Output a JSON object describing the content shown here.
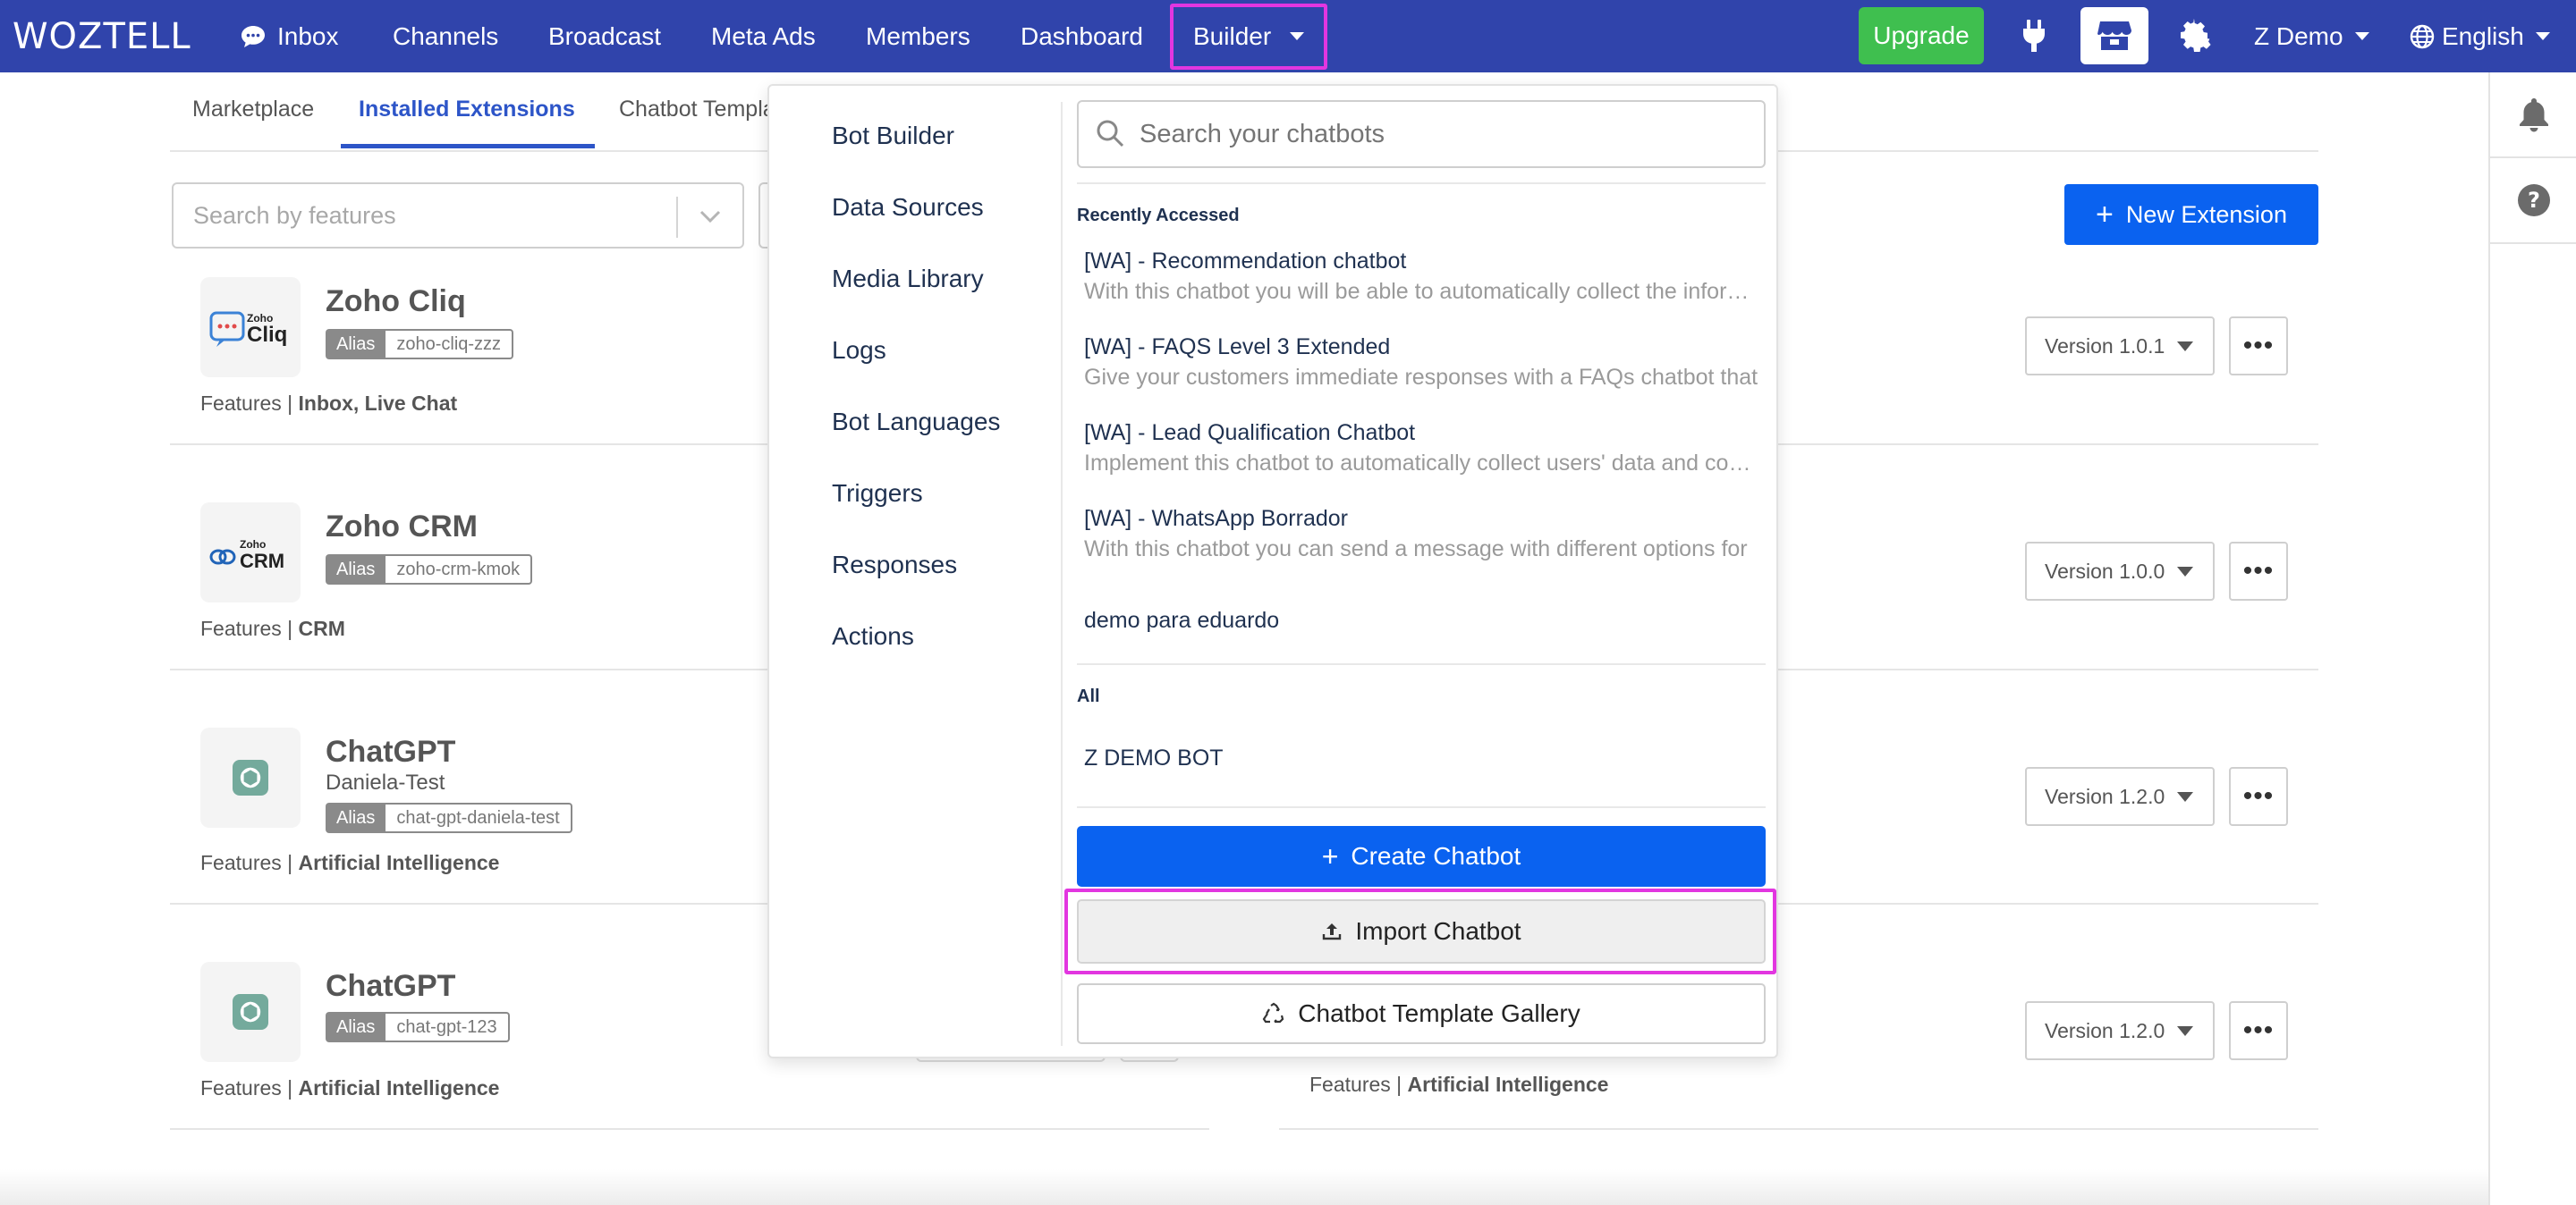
{
  "brand": {
    "logo_text": "WOZTELL"
  },
  "nav": {
    "inbox": "Inbox",
    "channels": "Channels",
    "broadcast": "Broadcast",
    "meta_ads": "Meta Ads",
    "members": "Members",
    "dashboard": "Dashboard",
    "builder": "Builder",
    "upgrade": "Upgrade",
    "account": "Z Demo",
    "language": "English"
  },
  "tabs": {
    "marketplace": "Marketplace",
    "installed": "Installed Extensions",
    "chatbot_templates": "Chatbot Templa"
  },
  "filters": {
    "feature_search_placeholder": "Search by features",
    "new_extension": "New Extension"
  },
  "extensions": [
    {
      "name": "Zoho Cliq",
      "subtitle": "",
      "alias_key": "Alias",
      "alias": "zoho-cliq-zzz",
      "features_label": "Features |",
      "features": "Inbox, Live Chat",
      "version": "Version 1.0.1",
      "logo_line1": "Zoho",
      "logo_line2": "Cliq"
    },
    {
      "name": "Zoho CRM",
      "subtitle": "",
      "alias_key": "Alias",
      "alias": "zoho-crm-kmok",
      "features_label": "Features |",
      "features": "CRM",
      "version": "Version 1.0.0",
      "logo_line1": "Zoho",
      "logo_line2": "CRM"
    },
    {
      "name": "ChatGPT",
      "subtitle": "Daniela-Test",
      "alias_key": "Alias",
      "alias": "chat-gpt-daniela-test",
      "features_label": "Features |",
      "features": "Artificial Intelligence",
      "version": "Version 1.2.0"
    },
    {
      "name": "ChatGPT",
      "subtitle": "",
      "alias_key": "Alias",
      "alias": "chat-gpt-123",
      "features_label": "Features |",
      "features": "Artificial Intelligence",
      "version": "Version 1.2.0"
    }
  ],
  "more_label": "•••",
  "ghost_features": {
    "label": "Features |",
    "value": "Artificial Intelligence"
  },
  "builder_menu": {
    "links": [
      "Bot Builder",
      "Data Sources",
      "Media Library",
      "Logs",
      "Bot Languages",
      "Triggers",
      "Responses",
      "Actions"
    ],
    "search_placeholder": "Search your chatbots",
    "recent_heading": "Recently Accessed",
    "recent": [
      {
        "title": "[WA] - Recommendation chatbot",
        "desc": "With this chatbot you will be able to automatically collect the information"
      },
      {
        "title": "[WA] - FAQS Level 3 Extended",
        "desc": "Give your customers immediate responses with a FAQs chatbot that"
      },
      {
        "title": "[WA] - Lead Qualification Chatbot",
        "desc": "Implement this chatbot to automatically collect users' data and convert"
      },
      {
        "title": "[WA] - WhatsApp Borrador",
        "desc": "With this chatbot you can send a message with different options for"
      },
      {
        "title": "demo para eduardo",
        "desc": ""
      }
    ],
    "all_heading": "All",
    "all": [
      {
        "title": "Z DEMO BOT"
      }
    ],
    "create": "Create Chatbot",
    "import": "Import Chatbot",
    "gallery": "Chatbot Template Gallery"
  },
  "colors": {
    "nav_bg": "#3044ab",
    "primary": "#0a62f0",
    "upgrade": "#3fbf4f",
    "highlight": "#e236e0"
  }
}
